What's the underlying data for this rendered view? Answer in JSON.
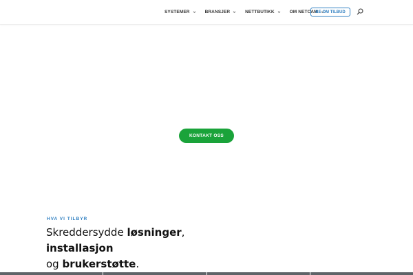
{
  "header": {
    "nav": [
      {
        "label": "SYSTEMER"
      },
      {
        "label": "BRANSJER"
      },
      {
        "label": "NETTBUTIKK"
      },
      {
        "label": "OM NETCAM"
      }
    ],
    "cta_label": "BE OM TILBUD",
    "search_icon": "search-icon",
    "chevron_icon": "chevron-down-icon"
  },
  "hero": {
    "button_label": "KONTAKT OSS",
    "button_color": "#1aa33a"
  },
  "offer": {
    "eyebrow": "HVA VI TILBYR",
    "heading_part1": "Skreddersydde ",
    "heading_bold1": "løsninger",
    "heading_part2": ", ",
    "heading_bold2": "installasjon",
    "heading_part3": "og ",
    "heading_bold3": "brukerstøtte",
    "heading_part4": "."
  },
  "colors": {
    "accent_blue": "#2f7fc1",
    "accent_green": "#1aa33a",
    "text_dark": "#111111"
  }
}
